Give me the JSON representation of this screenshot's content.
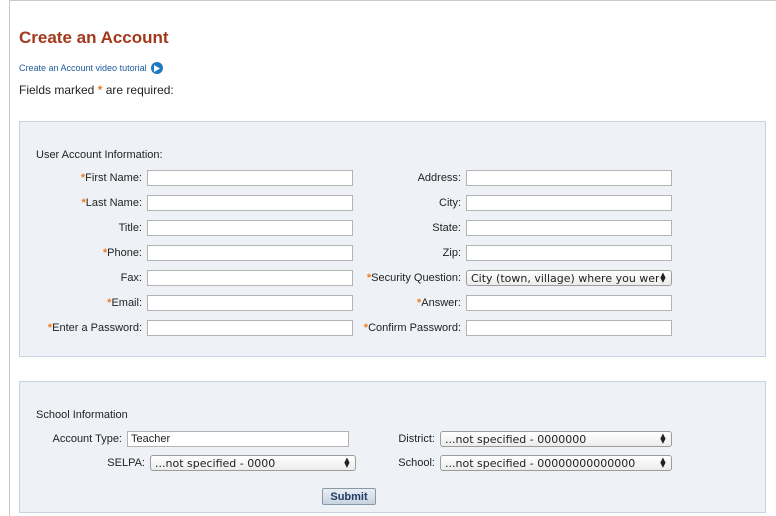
{
  "page": {
    "title": "Create an Account",
    "video_link": "Create an Account video tutorial",
    "required_note_prefix": "Fields marked",
    "required_star": "*",
    "required_note_suffix": "are required:"
  },
  "user_info": {
    "heading": "User Account Information:",
    "left_fields": [
      {
        "label": "First Name:",
        "required": true,
        "value": ""
      },
      {
        "label": "Last Name:",
        "required": true,
        "value": ""
      },
      {
        "label": "Title:",
        "required": false,
        "value": ""
      },
      {
        "label": "Phone:",
        "required": true,
        "value": ""
      },
      {
        "label": "Fax:",
        "required": false,
        "value": ""
      },
      {
        "label": "Email:",
        "required": true,
        "value": ""
      },
      {
        "label": "Enter a Password:",
        "required": true,
        "value": ""
      }
    ],
    "right_fields": [
      {
        "label": "Address:",
        "required": false,
        "value": ""
      },
      {
        "label": "City:",
        "required": false,
        "value": ""
      },
      {
        "label": "State:",
        "required": false,
        "value": ""
      },
      {
        "label": "Zip:",
        "required": false,
        "value": ""
      },
      {
        "label": "Security Question:",
        "required": true,
        "value": "City (town, village) where you were"
      },
      {
        "label": "Answer:",
        "required": true,
        "value": ""
      },
      {
        "label": "Confirm Password:",
        "required": true,
        "value": ""
      }
    ]
  },
  "school_info": {
    "heading": "School Information",
    "account_type_label": "Account Type:",
    "account_type_value": "Teacher",
    "selpa_label": "SELPA:",
    "selpa_value": "...not specified - 0000",
    "district_label": "District:",
    "district_value": "...not specified - 0000000",
    "school_label": "School:",
    "school_value": "...not specified - 00000000000000",
    "submit_label": "Submit"
  },
  "colors": {
    "title": "#a3391a",
    "required_star": "#f07a1a",
    "link": "#1f5b99",
    "panel_bg": "#eef2f7"
  },
  "icons": {
    "video": "play-circle-icon",
    "select_arrows": "up-down-arrows-icon"
  }
}
